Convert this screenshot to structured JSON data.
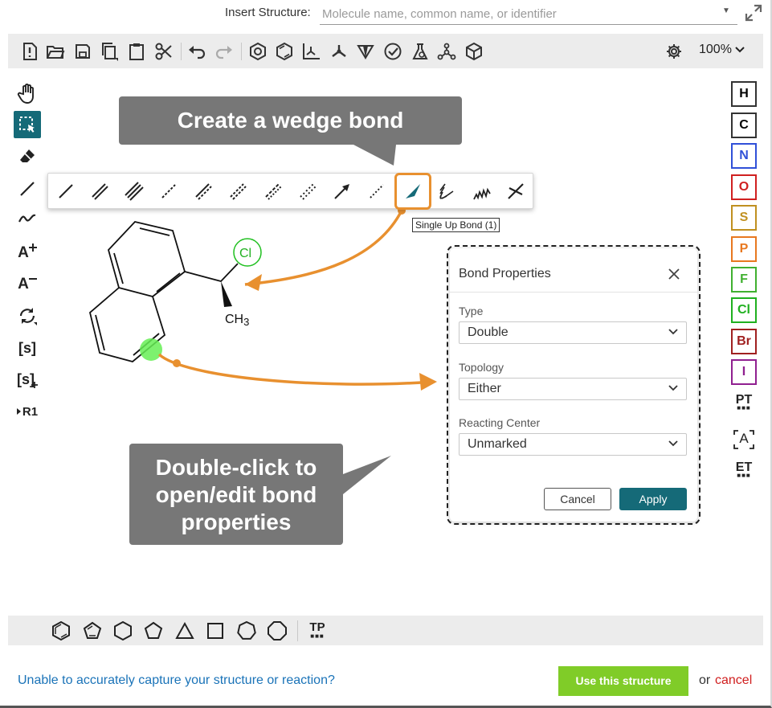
{
  "insert_bar": {
    "label": "Insert Structure:",
    "placeholder": "Molecule name, common name, or identifier"
  },
  "toolbar": {
    "zoom": "100%",
    "icons": [
      "new-document-icon",
      "open-folder-icon",
      "save-icon",
      "copy-icon",
      "paste-icon",
      "cut-icon",
      "undo-icon",
      "redo-icon",
      "aromatize-icon",
      "dearomatize-icon",
      "clean-layout-icon",
      "arrange-icon",
      "stereo-icon",
      "check-structure-icon",
      "calculate-icon",
      "3d-view-icon",
      "cube-icon",
      "settings-icon"
    ]
  },
  "left_tools": {
    "atom_plus_label": "A",
    "atom_minus_label": "A",
    "sgroup_label": "[s]",
    "sgroup_plus_label": "[s]",
    "rgroup_label": "R1"
  },
  "elements": [
    "H",
    "C",
    "N",
    "O",
    "S",
    "P",
    "F",
    "Cl",
    "Br",
    "I"
  ],
  "element_colors": {
    "H": "#000000",
    "C": "#000000",
    "N": "#3050d8",
    "O": "#d02020",
    "S": "#c09020",
    "P": "#e87820",
    "F": "#40b030",
    "Cl": "#20b020",
    "Br": "#a02020",
    "I": "#902090"
  },
  "right_tools": {
    "periodic_table_label": "PT",
    "text_label": "A",
    "extended_table_label": "ET"
  },
  "callouts": {
    "top": "Create a wedge bond",
    "bottom_lines": [
      "Double-click to",
      "open/edit bond",
      "properties"
    ]
  },
  "bond_tooltip": "Single Up Bond (1)",
  "molecule": {
    "chlorine_label": "Cl",
    "methyl_label": "CH",
    "methyl_subscript": "3"
  },
  "dialog": {
    "title": "Bond Properties",
    "type_label": "Type",
    "type_value": "Double",
    "topology_label": "Topology",
    "topology_value": "Either",
    "center_label": "Reacting Center",
    "center_value": "Unmarked",
    "cancel": "Cancel",
    "apply": "Apply"
  },
  "templates_label": "TP",
  "footer": {
    "link": "Unable to accurately capture your structure or reaction?",
    "use_button": "Use this structure",
    "or": "or",
    "cancel": "cancel"
  },
  "colors": {
    "accent": "#156a78",
    "callout": "#777777",
    "highlight_orange": "#e8902f",
    "use_button": "#80cc28",
    "cancel_red": "#d01e1e"
  }
}
